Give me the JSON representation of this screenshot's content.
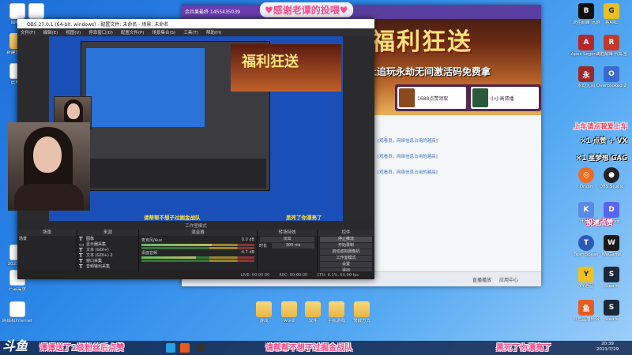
{
  "desktop_left": [
    {
      "label": "回收站",
      "icon": "recycle-bin-icon"
    },
    {
      "label": "桌面",
      "icon": "document-icon"
    },
    {
      "label": "新建文件夹",
      "icon": "folder-icon"
    }
  ],
  "desktop_right_top": [
    {
      "label": "决胜巅峰 迅游",
      "icon": "black-game-icon"
    },
    {
      "label": "格ARL",
      "icon": "yellow-game-icon"
    },
    {
      "label": "Apex Legends",
      "icon": "apex-icon"
    },
    {
      "label": "决胜巅峰 代练室",
      "icon": "red-game-icon"
    },
    {
      "label": "永劫无间",
      "icon": "naraka-icon"
    },
    {
      "label": "Overcooked 2",
      "icon": "overcooked-icon"
    }
  ],
  "desktop_right_mid": [
    {
      "label": "Origin",
      "icon": "origin-icon"
    },
    {
      "label": "OBS Studio",
      "icon": "obs-icon"
    },
    {
      "label": "开黑啦",
      "icon": "kaiheila-icon"
    },
    {
      "label": "Discord",
      "icon": "discord-icon"
    },
    {
      "label": "TeamSpeak",
      "icon": "teamspeak-icon"
    },
    {
      "label": "WeGame",
      "icon": "wegame-icon"
    },
    {
      "label": "YY语音",
      "icon": "yy-icon"
    },
    {
      "label": "Steam",
      "icon": "steam-icon"
    },
    {
      "label": "斗鱼直播伴侣",
      "icon": "douyu-icon"
    },
    {
      "label": "Steam",
      "icon": "steam-icon"
    }
  ],
  "desktop_bottom_folders": [
    "游戏",
    "word",
    "软件",
    "手机游戏",
    "快捷方式"
  ],
  "desktop_left_low": [
    {
      "label": "此电脑",
      "icon": "pc-icon"
    },
    {
      "label": "2021年...",
      "icon": "document-icon"
    },
    {
      "label": "产品需求",
      "icon": "document-icon"
    },
    {
      "label": "网络和Internet",
      "icon": "network-icon"
    }
  ],
  "overlay": {
    "thanks_banner": "♥感谢老谭的投喂♥",
    "gift_tag": "余兵果最终 1455435039",
    "promo_lines": [
      "上车请点我爱上车",
      "×1 点赞 + VX",
      "×1 星梦想 GAG"
    ],
    "follow_tag": "投递点赞",
    "bottom_left_caption": "谭谭送了1级粉丝后点赞",
    "bottom_mid_caption": "请帮帮不想子过掘金战队",
    "bottom_right_caption": "黑死了你漂亮了"
  },
  "game": {
    "banner": "福利狂送",
    "subtitle": "上追玩永劫无间激活码免费拿",
    "tab1": "1688点赞领取",
    "tab2": "小小高清播",
    "chat": [
      "[观看员，网络信息占用的越高]",
      "[观看员，网络信息占用的越高]",
      "[观看员，网络信息占用的越高]"
    ],
    "status_items": [
      "直播播放",
      "应用中心"
    ]
  },
  "obs": {
    "title": "OBS 27.0.1 (64-bit, windows) - 配置文件: 未命名 - 场景: 未命名",
    "menu": [
      "文件(F)",
      "编辑(E)",
      "视图(V)",
      "停靠窗口(D)",
      "配置文件(P)",
      "场景集合(S)",
      "工具(T)",
      "帮助(H)"
    ],
    "mode_label": "工作室模式",
    "docks": {
      "scenes": "场景",
      "sources": "来源",
      "mixer": "混音器",
      "transitions": "转场特效",
      "controls": "控件"
    },
    "scene_item": "场景",
    "sources": [
      "图像",
      "显示器采集",
      "文本 (GDI+)",
      "文本 (GDI+) 2",
      "窗口采集",
      "音频输出采集"
    ],
    "mixer": [
      {
        "name": "麦克风/Aux",
        "db": "0.0 dB",
        "level": 0.62
      },
      {
        "name": "桌面音频",
        "db": "-4.7 dB",
        "level": 0.48
      }
    ],
    "transition": "淡出",
    "duration_label": "时长",
    "duration": "300 ms",
    "controls": [
      "停止推流",
      "开始录制",
      "启动虚拟摄像机",
      "工作室模式",
      "设置",
      "退出"
    ],
    "status": [
      "LIVE: 00:00:00",
      "REC: 00:00:00",
      "CPU: 6.1%, 60.00 fps"
    ]
  },
  "taskbar": {
    "logo": "斗鱼",
    "time": "20:39",
    "date": "2021/7/29"
  }
}
